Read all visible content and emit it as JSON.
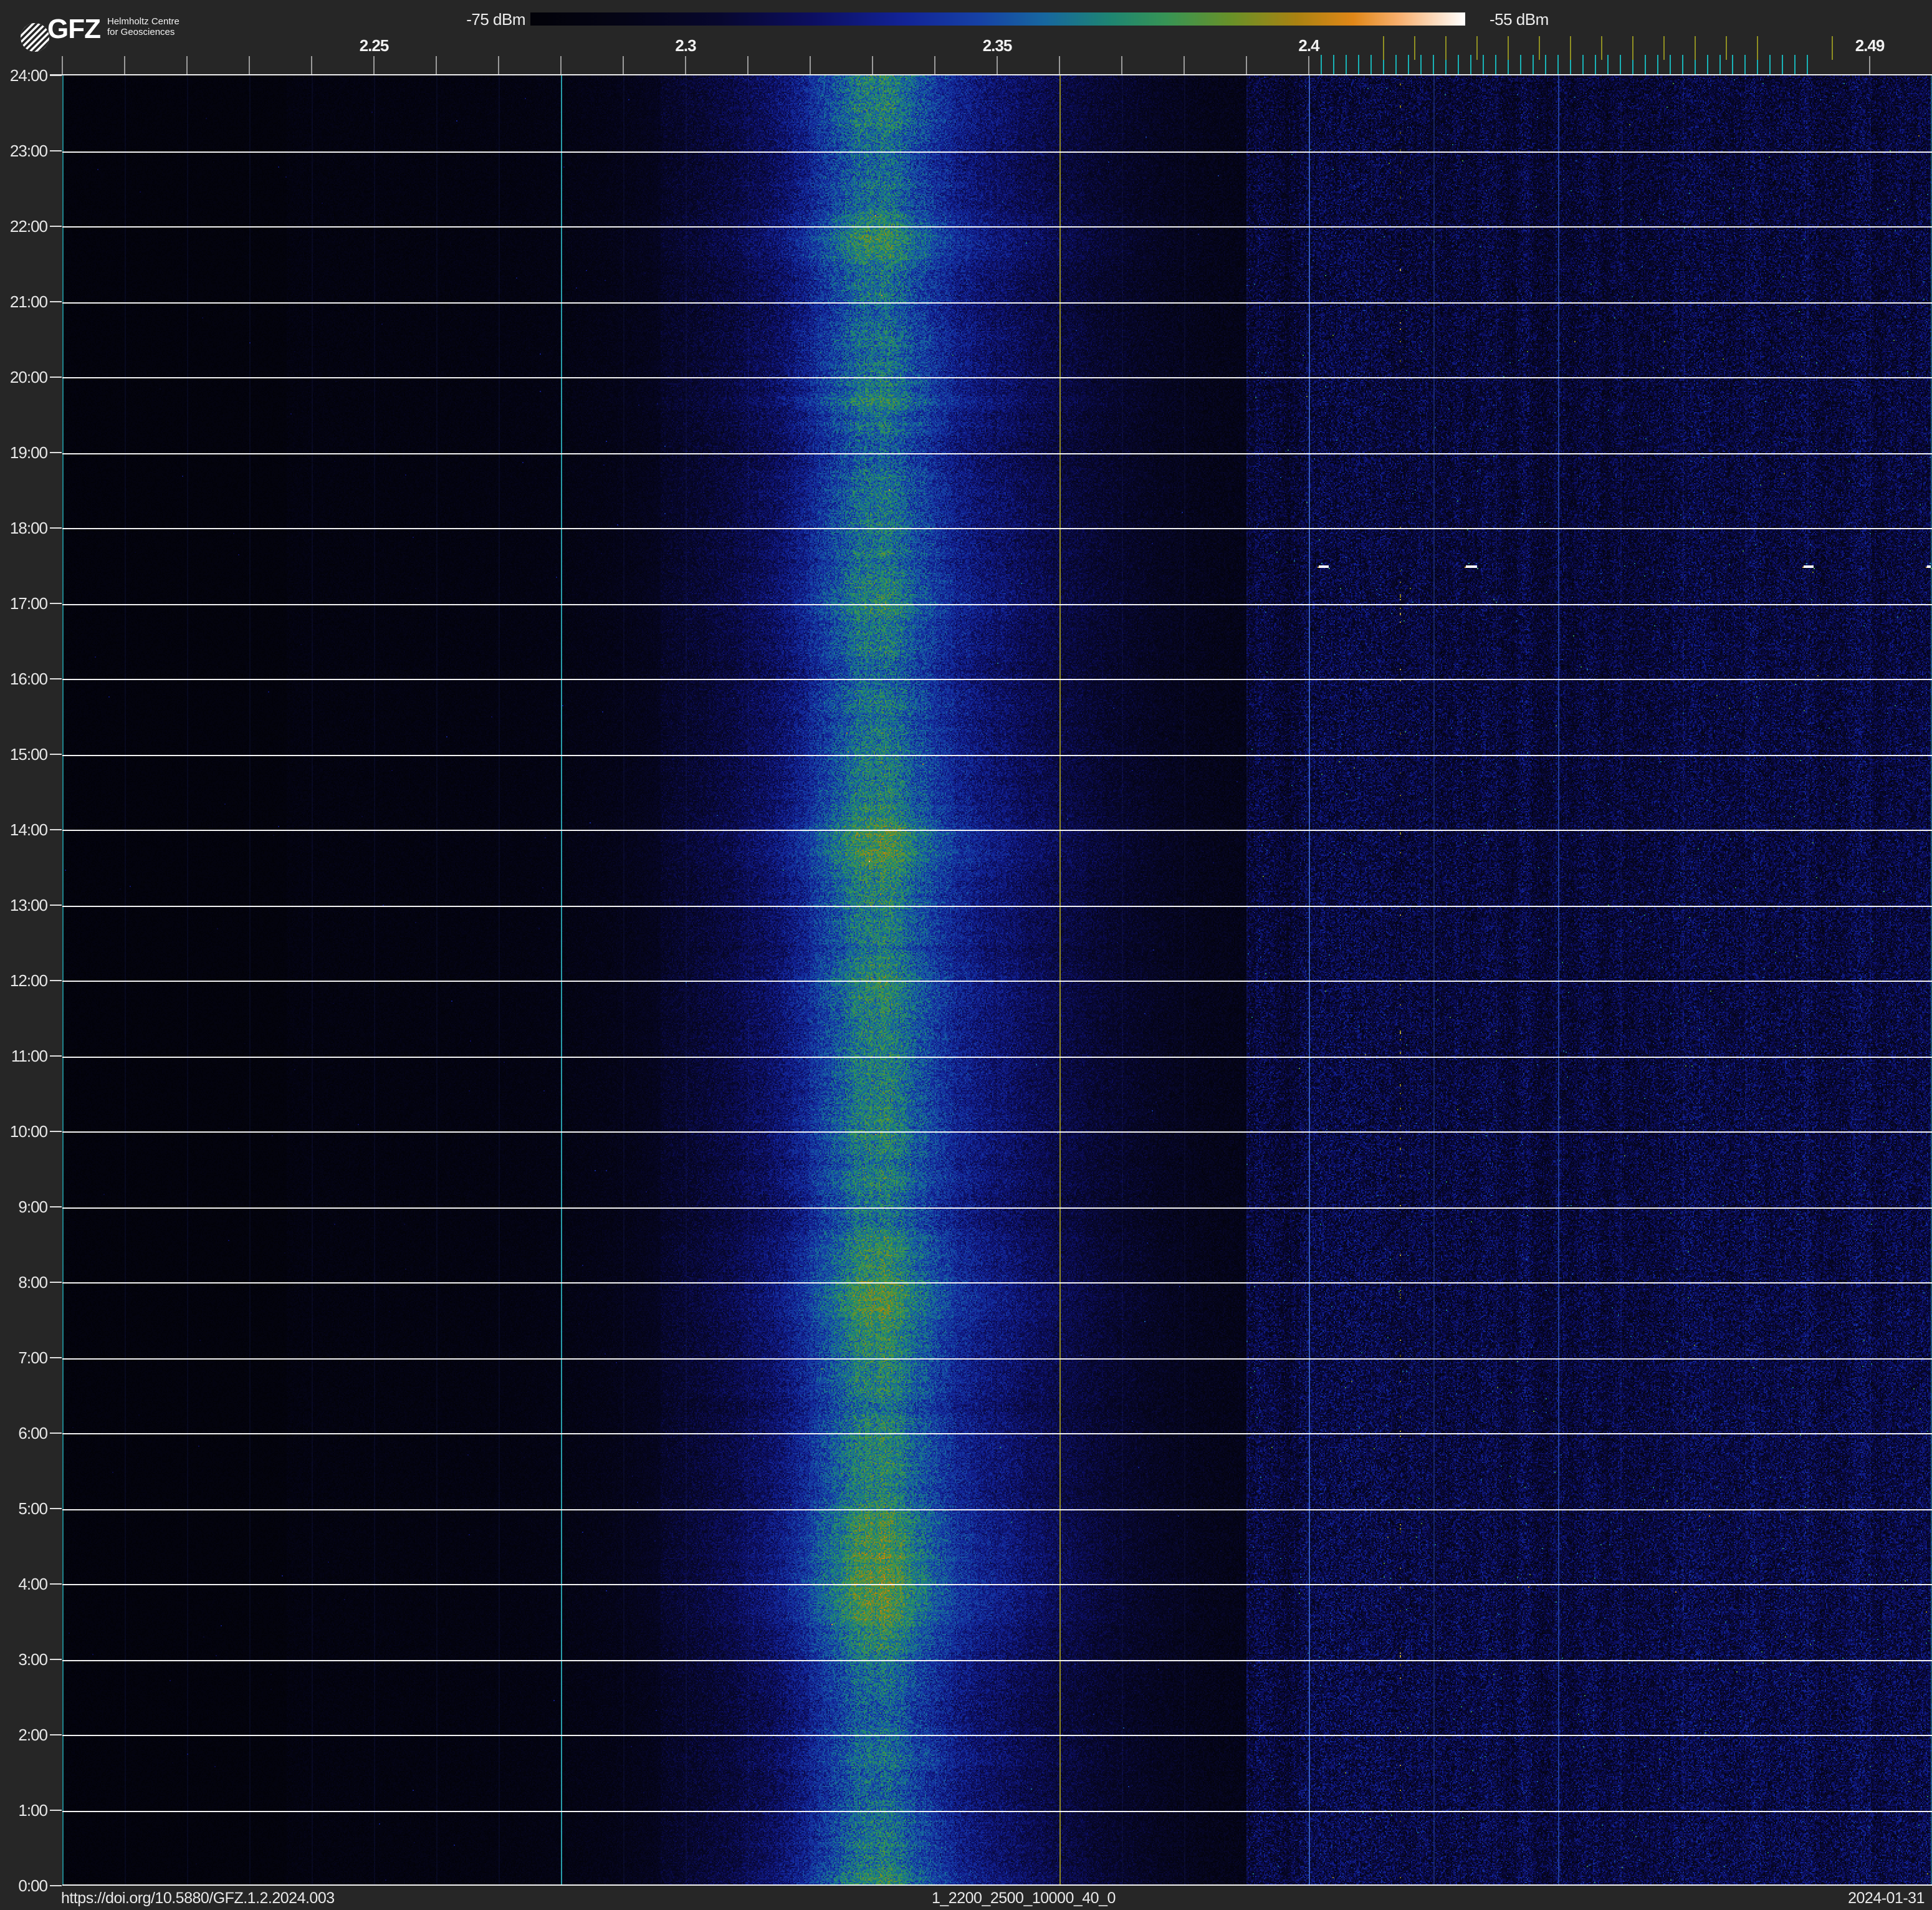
{
  "header": {
    "logo": {
      "acronym": "GFZ",
      "line1": "Helmholtz Centre",
      "line2": "for Geosciences"
    },
    "colorbar": {
      "min_label": "-75 dBm",
      "max_label": "-55 dBm"
    }
  },
  "footer": {
    "doi": "https://doi.org/10.5880/GFZ.1.2.2024.003",
    "dataset_id": "1_2200_2500_10000_40_0",
    "date": "2024-01-31"
  },
  "chart_data": {
    "type": "heatmap",
    "title": "24-hour radio-frequency spectrogram 2.2-2.5 GHz",
    "x_axis": {
      "unit": "GHz",
      "min_mhz": 2200,
      "max_mhz": 2500,
      "major_tick_step_mhz": 10,
      "labels": [
        {
          "mhz": 2250,
          "text": "2.25"
        },
        {
          "mhz": 2300,
          "text": "2.3"
        },
        {
          "mhz": 2350,
          "text": "2.35"
        },
        {
          "mhz": 2400,
          "text": "2.4"
        },
        {
          "mhz": 2490,
          "text": "2.49"
        }
      ]
    },
    "y_axis": {
      "unit": "time of day",
      "top_label": "24:00",
      "bottom_label": "0:00",
      "hour_labels": [
        "24:00",
        "23:00",
        "22:00",
        "21:00",
        "20:00",
        "19:00",
        "18:00",
        "17:00",
        "16:00",
        "15:00",
        "14:00",
        "13:00",
        "12:00",
        "11:00",
        "10:00",
        "9:00",
        "8:00",
        "7:00",
        "6:00",
        "5:00",
        "4:00",
        "3:00",
        "2:00",
        "1:00",
        "0:00"
      ]
    },
    "colorbar": {
      "min_dbm": -75,
      "max_dbm": -55
    },
    "colormap_stops": [
      [
        0.0,
        "#020208"
      ],
      [
        0.1,
        "#040416"
      ],
      [
        0.2,
        "#07072d"
      ],
      [
        0.3,
        "#0c0e5f"
      ],
      [
        0.4,
        "#122396"
      ],
      [
        0.48,
        "#1641a5"
      ],
      [
        0.55,
        "#17679f"
      ],
      [
        0.62,
        "#1e8572"
      ],
      [
        0.68,
        "#379455"
      ],
      [
        0.75,
        "#699128"
      ],
      [
        0.82,
        "#aa8212"
      ],
      [
        0.88,
        "#e08718"
      ],
      [
        0.93,
        "#f8b070"
      ],
      [
        1.0,
        "#ffffff"
      ]
    ],
    "wifi_channel_ticks_mhz": [
      2412,
      2417,
      2422,
      2427,
      2432,
      2437,
      2442,
      2447,
      2452,
      2457,
      2462,
      2467,
      2472,
      2484
    ],
    "ble_channel_ticks_mhz": [
      2402,
      2404,
      2406,
      2408,
      2410,
      2412,
      2414,
      2416,
      2418,
      2420,
      2422,
      2424,
      2426,
      2428,
      2430,
      2432,
      2434,
      2436,
      2438,
      2440,
      2442,
      2444,
      2446,
      2448,
      2450,
      2452,
      2454,
      2456,
      2458,
      2460,
      2462,
      2464,
      2466,
      2468,
      2470,
      2472,
      2474,
      2476,
      2478,
      2480
    ],
    "band": {
      "wide_center_mhz": 2334,
      "wide_sigma_mhz": 34,
      "wide_amp": 0.32,
      "core_center_mhz": 2330,
      "core_sigma_mhz": 10,
      "core_amp": 0.26
    },
    "noise_zones": [
      {
        "from_mhz": 2200,
        "to_mhz": 2236,
        "floor": 0.035,
        "noise": 0.035
      },
      {
        "from_mhz": 2236,
        "to_mhz": 2296,
        "floor": 0.06,
        "noise": 0.055
      },
      {
        "from_mhz": 2296,
        "to_mhz": 2390,
        "floor": 0.09,
        "noise": 0.075
      },
      {
        "from_mhz": 2390,
        "to_mhz": 2500,
        "floor": 0.165,
        "noise": 0.145
      }
    ],
    "right_zone_bottom_boost": 0.05,
    "marker_lines": [
      {
        "mhz": 2200,
        "color": "#28a2ac",
        "alpha": 0.8
      },
      {
        "mhz": 2280,
        "color": "#2aa7b2",
        "alpha": 0.95
      },
      {
        "mhz": 2360,
        "color": "#99901e",
        "alpha": 0.95
      },
      {
        "mhz": 2400,
        "color": "#3f6fd0",
        "alpha": 0.85
      },
      {
        "mhz": 2420,
        "color": "#2e55b8",
        "alpha": 0.35
      },
      {
        "mhz": 2440,
        "color": "#2e5cc4",
        "alpha": 0.6
      },
      {
        "mhz": 2500,
        "color": "#2897a8",
        "alpha": 0.55
      }
    ],
    "dotted_line": {
      "mhz": 2414.5,
      "dot_count": 85,
      "colors": [
        "rgba(150,140,30,0.9)",
        "rgba(110,100,20,0.7)",
        "rgba(190,170,60,0.95)"
      ]
    },
    "events": [
      {
        "time": "17:30",
        "mhz": 2402.4,
        "w": 8
      },
      {
        "time": "17:30",
        "mhz": 2426.0,
        "w": 9
      },
      {
        "time": "17:30",
        "mhz": 2480.2,
        "w": 8
      },
      {
        "time": "17:30",
        "mhz": 2499.4,
        "w": 3
      }
    ]
  }
}
